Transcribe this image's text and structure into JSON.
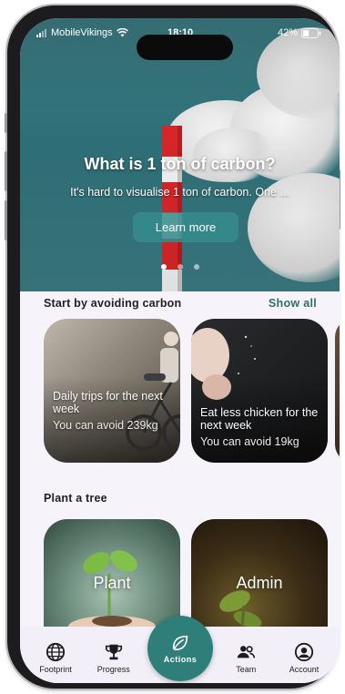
{
  "status_bar": {
    "carrier": "MobileVikings",
    "time": "18:10",
    "battery": "42%",
    "battery_level": 0.42
  },
  "hero": {
    "title": "What is 1 ton of carbon?",
    "subtitle": "It's hard to visualise 1 ton of carbon. One ...",
    "button_label": "Learn more",
    "page_count": 3,
    "active_page": 1
  },
  "avoid_section": {
    "title": "Start by avoiding carbon",
    "show_all_label": "Show all",
    "cards": [
      {
        "title": "Daily trips for the next week",
        "subtitle": "You can avoid 239kg"
      },
      {
        "title": "Eat less chicken for the next week",
        "subtitle": "You can avoid 19kg"
      }
    ]
  },
  "tree_section": {
    "title": "Plant a tree",
    "cards": [
      {
        "label": "Plant"
      },
      {
        "label": "Admin"
      }
    ]
  },
  "nav": {
    "items": [
      {
        "label": "Footprint",
        "icon": "globe-icon"
      },
      {
        "label": "Progress",
        "icon": "trophy-icon"
      },
      {
        "label": "Actions",
        "icon": "leaf-icon"
      },
      {
        "label": "Team",
        "icon": "team-icon"
      },
      {
        "label": "Account",
        "icon": "account-icon"
      }
    ]
  },
  "colors": {
    "accent": "#2e7f79",
    "hero_sky": "#3d7f86",
    "background": "#f6f3fb"
  }
}
